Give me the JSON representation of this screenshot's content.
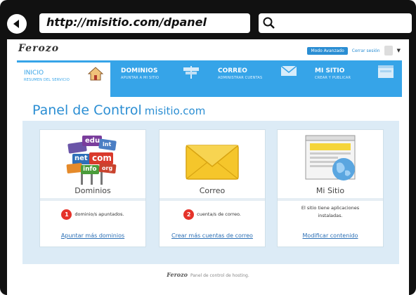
{
  "browser": {
    "url": "http://misitio.com/dpanel"
  },
  "header": {
    "logo": "Ferozo",
    "mode_button": "Modo Avanzado",
    "logout": "Cerrar sesión"
  },
  "nav": {
    "tabs": [
      {
        "title": "INICIO",
        "subtitle": "RESUMEN DEL SERVICIO"
      },
      {
        "title": "DOMINIOS",
        "subtitle": "APUNTAR A MI SITIO"
      },
      {
        "title": "CORREO",
        "subtitle": "ADMINISTRAR CUENTAS"
      },
      {
        "title": "MI SITIO",
        "subtitle": "CREAR Y PUBLICAR"
      }
    ]
  },
  "main": {
    "title": "Panel de Control",
    "domain": "misitio.com",
    "cards": [
      {
        "label": "Dominios",
        "count": "1",
        "stat": "dominio/s apuntados.",
        "link": "Apuntar más dominios",
        "tags": [
          "edu",
          "net",
          "com",
          "info",
          "int",
          "org"
        ]
      },
      {
        "label": "Correo",
        "count": "2",
        "stat": "cuenta/s de correo.",
        "link": "Crear más cuentas de correo"
      },
      {
        "label": "Mi Sitio",
        "stat_line1": "El sitio tiene aplicaciones",
        "stat_line2": "instaladas.",
        "link": "Modificar contenido"
      }
    ]
  },
  "footer": {
    "logo": "Ferozo",
    "text": "Panel de control de hosting."
  },
  "colors": {
    "accent": "#36a4e8",
    "badge": "#e5332a",
    "link": "#2b6fb5"
  }
}
